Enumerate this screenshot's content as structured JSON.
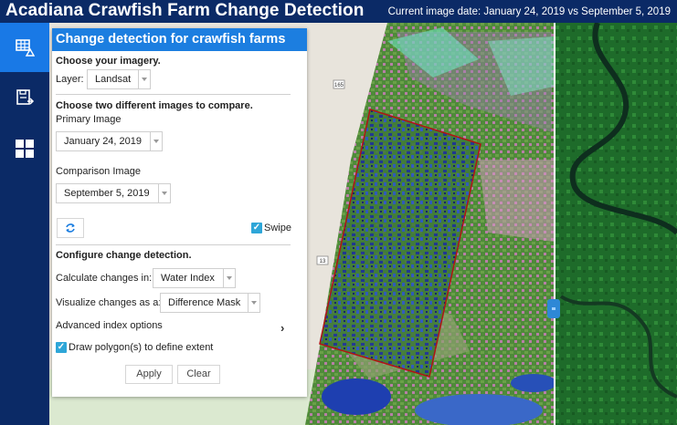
{
  "header": {
    "title": "Acadiana Crawfish Farm Change Detection",
    "image_date": "Current image date: January 24, 2019 vs September 5, 2019"
  },
  "toolbar": {
    "items": [
      {
        "icon": "change-detection-grid-icon",
        "active": true
      },
      {
        "icon": "save-export-icon",
        "active": false
      },
      {
        "icon": "apps-grid-icon",
        "active": false
      }
    ]
  },
  "panel": {
    "title": "Change detection for crawfish farms",
    "choose_imagery": "Choose your imagery.",
    "layer_label": "Layer:",
    "layer_value": "Landsat",
    "compare_heading": "Choose two different images to compare.",
    "primary_label": "Primary Image",
    "primary_value": "January 24, 2019",
    "comparison_label": "Comparison Image",
    "comparison_value": "September 5, 2019",
    "swipe_label": "Swipe",
    "swipe_checked": true,
    "configure_heading": "Configure change detection.",
    "calc_label": "Calculate changes in:",
    "calc_value": "Water Index",
    "visualize_label": "Visualize changes as a:",
    "visualize_value": "Difference Mask",
    "advanced_label": "Advanced index options",
    "polygon_label": "Draw polygon(s) to define extent",
    "polygon_checked": true,
    "apply_label": "Apply",
    "clear_label": "Clear"
  },
  "map": {
    "road_labels": [
      "165",
      "13"
    ],
    "colors": {
      "aoi_outline": "#b01414",
      "water": "#1e3fb0",
      "swipe_line": "#ffffff",
      "basemap": "#e8e4dc"
    }
  }
}
